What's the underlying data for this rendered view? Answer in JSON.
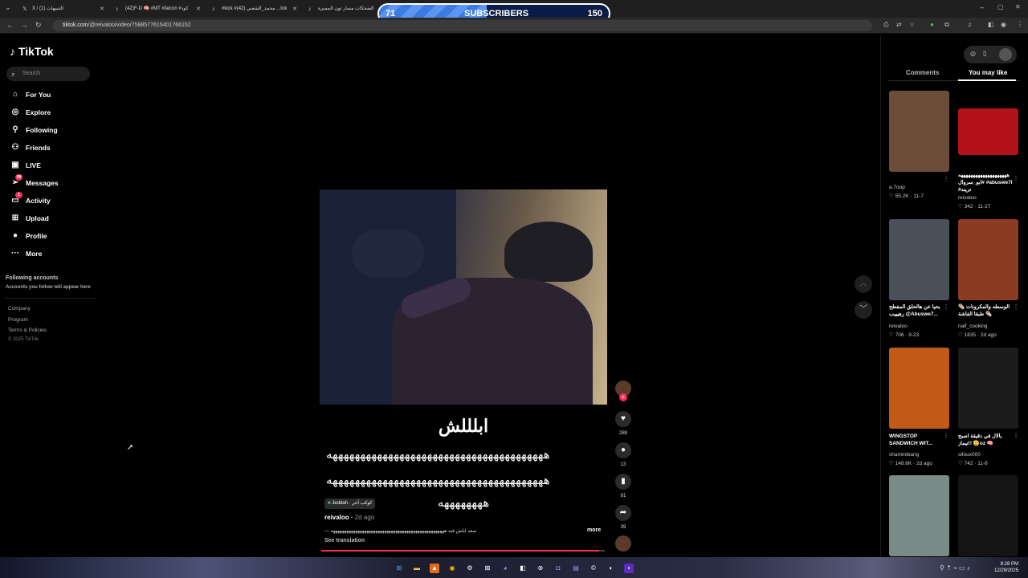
{
  "browser": {
    "tabs": [
      {
        "title": "X / التنبيهات (1)",
        "icon": "x-logo-icon"
      },
      {
        "title": "(4Z)F-D 🧠 #MT #falcon #كود",
        "icon": "tiktok-icon"
      },
      {
        "title": "#kick #محمد_الشعبي (42) ...tok",
        "icon": "tiktok-icon"
      },
      {
        "title": "الضحكات مسار تون المميزة",
        "icon": "tiktok-icon"
      }
    ],
    "url_domain": "tiktok.com",
    "url_path": "/@reivaloo/video/7588577615401766152"
  },
  "overlay": {
    "label": "SUBSCRIBERS",
    "current": "71",
    "goal": "150",
    "progress": 0.47
  },
  "sidebar": {
    "logo": "TikTok",
    "search_placeholder": "Search",
    "items": [
      {
        "label": "For You",
        "icon": "home-icon"
      },
      {
        "label": "Explore",
        "icon": "compass-icon"
      },
      {
        "label": "Following",
        "icon": "user-plus-icon"
      },
      {
        "label": "Friends",
        "icon": "friends-icon"
      },
      {
        "label": "LIVE",
        "icon": "live-icon"
      },
      {
        "label": "Messages",
        "icon": "send-icon",
        "badge": "99"
      },
      {
        "label": "Activity",
        "icon": "inbox-icon",
        "badge": "1"
      },
      {
        "label": "Upload",
        "icon": "plus-square-icon"
      },
      {
        "label": "Profile",
        "icon": "avatar-icon"
      },
      {
        "label": "More",
        "icon": "more-icon"
      }
    ],
    "following_title": "Following accounts",
    "following_sub": "Accounts you follow will appear here",
    "footer": [
      "Company",
      "Program",
      "Terms & Policies",
      "© 2025 TikTok"
    ]
  },
  "video": {
    "caption": "ابلللش",
    "scribble_lines": [
      "هههههههههههههههههههههههههههههههههههههههه",
      "هههههههههههههههههههههههههههههههههههههههه",
      "ههههههههه"
    ],
    "location": "Jeddah · كوكب آخر",
    "author": "reivaloo",
    "posted": "2d ago",
    "description": "— سعد ابلش فيه هههههههههههههههههههههههههههههههههههههههههههههههههههه",
    "more": "more",
    "see_translation": "See translation",
    "progress": 0.98,
    "stats": {
      "likes": "288",
      "comments": "13",
      "saves": "91",
      "shares": "39"
    }
  },
  "right_panel": {
    "tabs": [
      "Comments",
      "You may like"
    ],
    "active_tab": "You may like",
    "cards": [
      {
        "title": "",
        "user": "a.7oop",
        "stats": "55.2K · 11-7",
        "color": "#6b4d3a"
      },
      {
        "title": "ههههههههههههههههههههه #ابو_سروال #abuswe7l #تريند",
        "user": "reivaloo",
        "stats": "342 · 11-27",
        "color": "#b3121b"
      },
      {
        "title": "بحيا عن هالحلق المفطح رهيييب @Abuswe7...",
        "user": "reivaloo",
        "stats": "706 · 9-23",
        "color": "#4a4f59"
      },
      {
        "title": "الوسطه والمكرونات 🌯🌯 طبقا الفاشة الاسطوري",
        "user": "naif_cooking",
        "stats": "1835 · 2d ago",
        "color": "#8a3b22"
      },
      {
        "title": "WINGSTOP SANDWICH WIT...",
        "user": "shammibang",
        "stats": "148.6K · 2d ago",
        "color": "#c05a16"
      },
      {
        "title": "بالال في دقيقة اصبح تيماز!! 🫡oz 🧠",
        "user": "sifoux000",
        "stats": "742 · 11-8",
        "color": "#1c1c1c"
      },
      {
        "title": "",
        "user": "",
        "stats": "",
        "color": "#7a8a86"
      },
      {
        "title": "",
        "user": "",
        "stats": "",
        "color": "#141414"
      }
    ]
  },
  "taskbar": {
    "time": "8:28 PM",
    "date": "12/29/2025"
  }
}
